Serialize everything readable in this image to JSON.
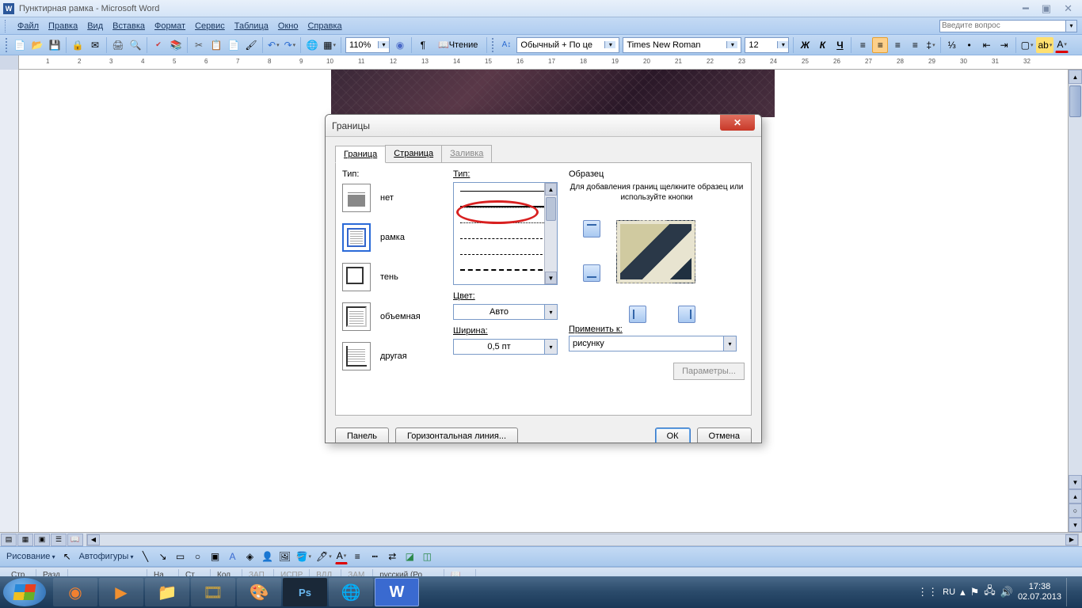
{
  "titlebar": {
    "title": "Пунктирная рамка - Microsoft Word"
  },
  "menu": {
    "file": "Файл",
    "edit": "Правка",
    "view": "Вид",
    "insert": "Вставка",
    "format": "Формат",
    "tools": "Сервис",
    "table": "Таблица",
    "window": "Окно",
    "help": "Справка",
    "ask_placeholder": "Введите вопрос"
  },
  "toolbar1": {
    "zoom": "110%",
    "read": "Чтение"
  },
  "toolbar2": {
    "style": "Обычный + По це",
    "font": "Times New Roman",
    "size": "12",
    "bold": "Ж",
    "italic": "К",
    "underline": "Ч"
  },
  "drawing": {
    "label": "Рисование",
    "autoshapes": "Автофигуры"
  },
  "status": {
    "page_lbl": "Стр.",
    "sect_lbl": "Разд",
    "at_lbl": "На",
    "ln_lbl": "Ст",
    "col_lbl": "Кол",
    "rec": "ЗАП",
    "trk": "ИСПР",
    "ext": "ВДЛ",
    "ovr": "ЗАМ",
    "lang": "русский (Ро"
  },
  "dialog": {
    "title": "Границы",
    "tabs": {
      "border": "Граница",
      "page": "Страница",
      "fill": "Заливка"
    },
    "col1": {
      "label": "Тип:",
      "none": "нет",
      "box": "рамка",
      "shadow": "тень",
      "three_d": "объемная",
      "custom": "другая"
    },
    "col2": {
      "style_label": "Тип:",
      "color_label": "Цвет:",
      "color_value": "Авто",
      "width_label": "Ширина:",
      "width_value": "0,5 пт"
    },
    "col3": {
      "preview_label": "Образец",
      "hint": "Для добавления границ щелкните образец или используйте кнопки",
      "applyto_label": "Применить к:",
      "applyto_value": "рисунку",
      "params": "Параметры..."
    },
    "footer": {
      "panel": "Панель",
      "hline": "Горизонтальная линия...",
      "ok": "ОК",
      "cancel": "Отмена"
    }
  },
  "tray": {
    "lang": "RU",
    "time": "17:38",
    "date": "02.07.2013"
  }
}
